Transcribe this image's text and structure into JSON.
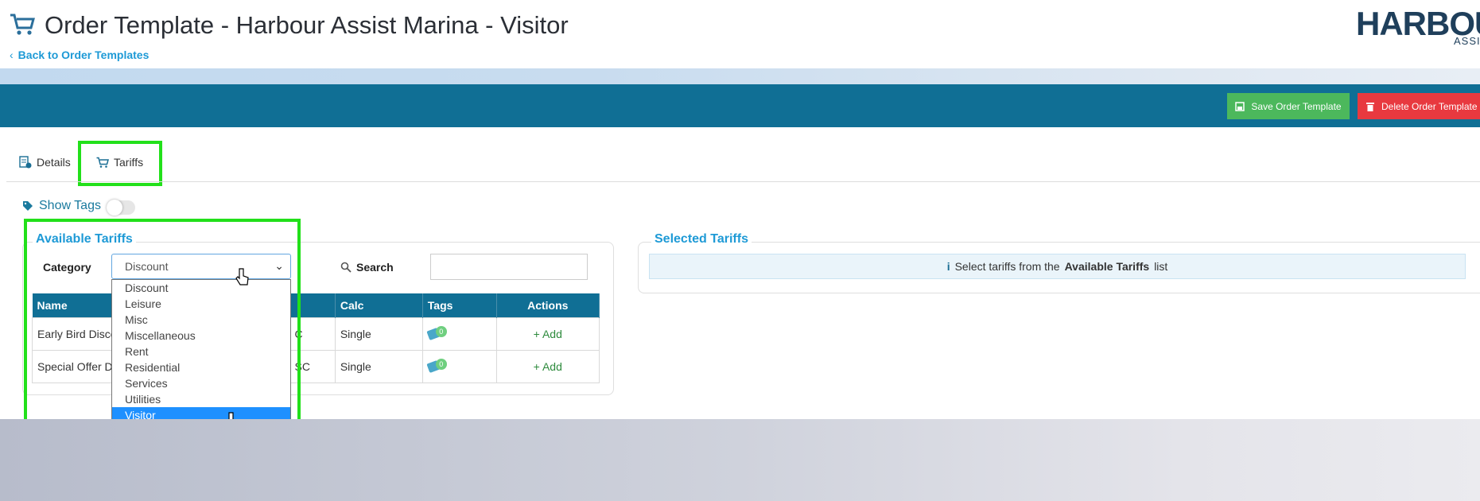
{
  "header": {
    "title": "Order Template - Harbour Assist Marina - Visitor",
    "back_link": "Back to Order Templates",
    "logo_text": "HARBOUR",
    "logo_sub": "ASSIS"
  },
  "toolbar": {
    "save_label": "Save Order Template",
    "delete_label": "Delete Order Template"
  },
  "tabs": [
    {
      "label": "Details"
    },
    {
      "label": "Tariffs"
    }
  ],
  "show_tags": {
    "label": "Show Tags",
    "enabled": false
  },
  "available": {
    "title": "Available Tariffs",
    "category_label": "Category",
    "category_value": "Discount",
    "search_label": "Search",
    "search_value": "",
    "columns": [
      "Name",
      "Calc",
      "Tags",
      "Actions"
    ],
    "rows": [
      {
        "name": "Early Bird Disco",
        "partial": "C",
        "calc": "Single",
        "tags": "0",
        "action": "Add"
      },
      {
        "name": "Special Offer Di",
        "partial": "SC",
        "calc": "Single",
        "tags": "0",
        "action": "Add"
      }
    ],
    "dropdown_options": [
      "Discount",
      "Leisure",
      "Misc",
      "Miscellaneous",
      "Rent",
      "Residential",
      "Services",
      "Utilities",
      "Visitor"
    ],
    "dropdown_highlighted": "Visitor"
  },
  "selected": {
    "title": "Selected Tariffs",
    "info_pre": "Select tariffs from the",
    "info_bold": "Available Tariffs",
    "info_post": "list"
  },
  "colors": {
    "toolbar": "#106f95",
    "save": "#4cb85c",
    "delete": "#e8393f",
    "highlight": "#22e01a",
    "link": "#1e9ad6"
  },
  "icons": [
    "cart-icon",
    "chevron-left-icon",
    "save-icon",
    "trash-icon",
    "details-icon",
    "tag-icon",
    "search-icon",
    "info-icon",
    "plus-icon",
    "chevron-down-icon",
    "pointer-cursor-icon"
  ]
}
